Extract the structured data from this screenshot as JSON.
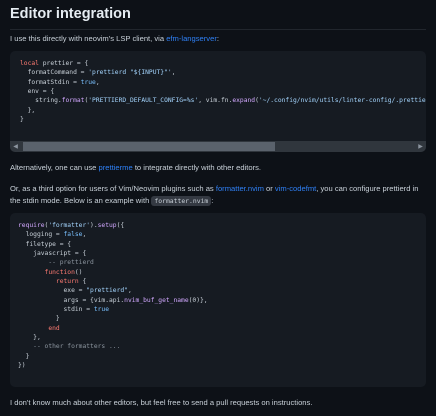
{
  "heading": "Editor integration",
  "intro": {
    "text": "I use this directly with neovim's LSP client, via ",
    "link": "efm-langserver",
    "suffix": ":"
  },
  "code1": {
    "lines": [
      "local prettier = {",
      "  formatCommand = 'prettierd \"${INPUT}\"',",
      "  formatStdin = true,",
      "  env = {",
      "    string.format('PRETTIERD_DEFAULT_CONFIG=%s', vim.fn.expand('~/.config/nvim/utils/linter-config/.prettierrc.json')),",
      "  },",
      "}"
    ],
    "scroll_left_icon": "triangle-left",
    "scroll_right_icon": "triangle-right",
    "scroll_position": 0
  },
  "alt": {
    "text": "Alternatively, one can use ",
    "link": "prettierme",
    "suffix": " to integrate directly with other editors."
  },
  "third": {
    "text1": "Or, as a third option for users of Vim/Neovim plugins such as ",
    "link1": "formatter.nvim",
    "text2": " or ",
    "link2": "vim-codefmt",
    "text3": ", you can configure prettierd in the stdin mode. Below is an example with ",
    "code": "formatter.nvim",
    "text4": ":"
  },
  "code2": {
    "lines": [
      "require('formatter').setup({",
      "  logging = false,",
      "  filetype = {",
      "    javascript = {",
      "        -- prettierd",
      "       function()",
      "          return {",
      "            exe = \"prettierd\",",
      "            args = {vim.api.nvim_buf_get_name(0)},",
      "            stdin = true",
      "          }",
      "        end",
      "    },",
      "    -- other formatters ...",
      "  }",
      "})"
    ]
  },
  "closing": "I don't know much about other editors, but feel free to send a pull requests on instructions."
}
